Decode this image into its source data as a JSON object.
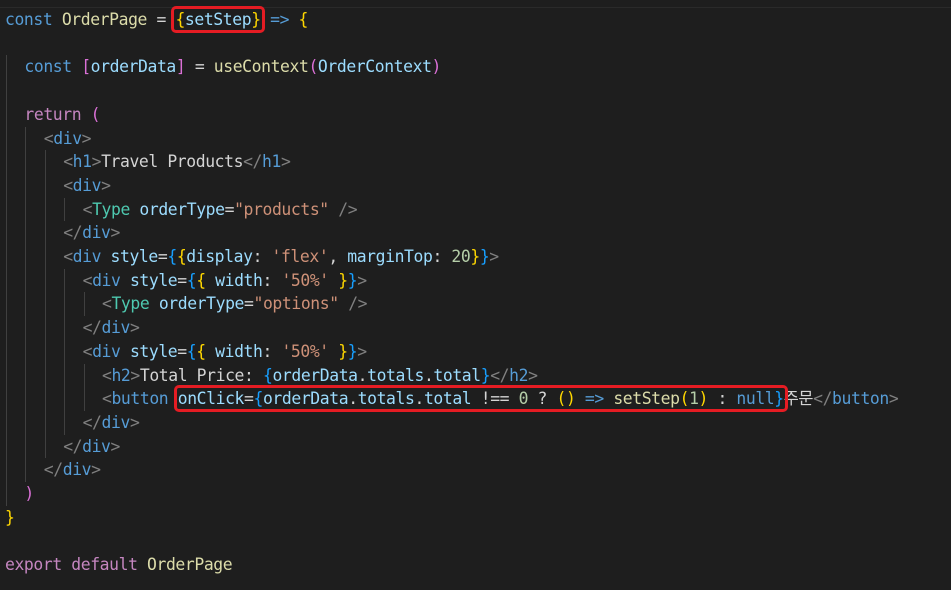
{
  "editor": {
    "lines": [
      {
        "indent": 0,
        "tokens": [
          {
            "t": "const",
            "c": "kw"
          },
          {
            "t": " ",
            "c": "p"
          },
          {
            "t": "OrderPage",
            "c": "func"
          },
          {
            "t": " = ",
            "c": "p"
          },
          {
            "t": "{",
            "c": "br1",
            "box": "a"
          },
          {
            "t": "setStep",
            "c": "var",
            "box": "a"
          },
          {
            "t": "}",
            "c": "br1",
            "box": "a"
          },
          {
            "t": " ",
            "c": "p"
          },
          {
            "t": "=>",
            "c": "kw"
          },
          {
            "t": " ",
            "c": "p"
          },
          {
            "t": "{",
            "c": "br1"
          }
        ]
      },
      {
        "indent": 0,
        "tokens": []
      },
      {
        "indent": 1,
        "tokens": [
          {
            "t": "const",
            "c": "kw"
          },
          {
            "t": " ",
            "c": "p"
          },
          {
            "t": "[",
            "c": "br2"
          },
          {
            "t": "orderData",
            "c": "var"
          },
          {
            "t": "]",
            "c": "br2"
          },
          {
            "t": " = ",
            "c": "p"
          },
          {
            "t": "useContext",
            "c": "func"
          },
          {
            "t": "(",
            "c": "br2"
          },
          {
            "t": "OrderContext",
            "c": "var"
          },
          {
            "t": ")",
            "c": "br2"
          }
        ]
      },
      {
        "indent": 0,
        "tokens": []
      },
      {
        "indent": 1,
        "tokens": [
          {
            "t": "return",
            "c": "ctrl"
          },
          {
            "t": " ",
            "c": "p"
          },
          {
            "t": "(",
            "c": "br2"
          }
        ]
      },
      {
        "indent": 2,
        "tokens": [
          {
            "t": "<",
            "c": "tagp"
          },
          {
            "t": "div",
            "c": "tag"
          },
          {
            "t": ">",
            "c": "tagp"
          }
        ]
      },
      {
        "indent": 3,
        "tokens": [
          {
            "t": "<",
            "c": "tagp"
          },
          {
            "t": "h1",
            "c": "tag"
          },
          {
            "t": ">",
            "c": "tagp"
          },
          {
            "t": "Travel Products",
            "c": "text"
          },
          {
            "t": "</",
            "c": "tagp"
          },
          {
            "t": "h1",
            "c": "tag"
          },
          {
            "t": ">",
            "c": "tagp"
          }
        ]
      },
      {
        "indent": 3,
        "tokens": [
          {
            "t": "<",
            "c": "tagp"
          },
          {
            "t": "div",
            "c": "tag"
          },
          {
            "t": ">",
            "c": "tagp"
          }
        ]
      },
      {
        "indent": 4,
        "tokens": [
          {
            "t": "<",
            "c": "tagp"
          },
          {
            "t": "Type",
            "c": "comp"
          },
          {
            "t": " ",
            "c": "p"
          },
          {
            "t": "orderType",
            "c": "attr"
          },
          {
            "t": "=",
            "c": "p"
          },
          {
            "t": "\"products\"",
            "c": "str"
          },
          {
            "t": " ",
            "c": "p"
          },
          {
            "t": "/>",
            "c": "tagp"
          }
        ]
      },
      {
        "indent": 3,
        "tokens": [
          {
            "t": "</",
            "c": "tagp"
          },
          {
            "t": "div",
            "c": "tag"
          },
          {
            "t": ">",
            "c": "tagp"
          }
        ]
      },
      {
        "indent": 3,
        "tokens": [
          {
            "t": "<",
            "c": "tagp"
          },
          {
            "t": "div",
            "c": "tag"
          },
          {
            "t": " ",
            "c": "p"
          },
          {
            "t": "style",
            "c": "attr"
          },
          {
            "t": "=",
            "c": "p"
          },
          {
            "t": "{",
            "c": "br3"
          },
          {
            "t": "{",
            "c": "br1"
          },
          {
            "t": "display",
            "c": "attr"
          },
          {
            "t": ": ",
            "c": "p"
          },
          {
            "t": "'flex'",
            "c": "str"
          },
          {
            "t": ", ",
            "c": "p"
          },
          {
            "t": "marginTop",
            "c": "attr"
          },
          {
            "t": ": ",
            "c": "p"
          },
          {
            "t": "20",
            "c": "num"
          },
          {
            "t": "}",
            "c": "br1"
          },
          {
            "t": "}",
            "c": "br3"
          },
          {
            "t": ">",
            "c": "tagp"
          }
        ]
      },
      {
        "indent": 4,
        "tokens": [
          {
            "t": "<",
            "c": "tagp"
          },
          {
            "t": "div",
            "c": "tag"
          },
          {
            "t": " ",
            "c": "p"
          },
          {
            "t": "style",
            "c": "attr"
          },
          {
            "t": "=",
            "c": "p"
          },
          {
            "t": "{",
            "c": "br3"
          },
          {
            "t": "{",
            "c": "br1"
          },
          {
            "t": " ",
            "c": "p"
          },
          {
            "t": "width",
            "c": "attr"
          },
          {
            "t": ": ",
            "c": "p"
          },
          {
            "t": "'50%'",
            "c": "str"
          },
          {
            "t": " ",
            "c": "p"
          },
          {
            "t": "}",
            "c": "br1"
          },
          {
            "t": "}",
            "c": "br3"
          },
          {
            "t": ">",
            "c": "tagp"
          }
        ]
      },
      {
        "indent": 5,
        "tokens": [
          {
            "t": "<",
            "c": "tagp"
          },
          {
            "t": "Type",
            "c": "comp"
          },
          {
            "t": " ",
            "c": "p"
          },
          {
            "t": "orderType",
            "c": "attr"
          },
          {
            "t": "=",
            "c": "p"
          },
          {
            "t": "\"options\"",
            "c": "str"
          },
          {
            "t": " ",
            "c": "p"
          },
          {
            "t": "/>",
            "c": "tagp"
          }
        ]
      },
      {
        "indent": 4,
        "tokens": [
          {
            "t": "</",
            "c": "tagp"
          },
          {
            "t": "div",
            "c": "tag"
          },
          {
            "t": ">",
            "c": "tagp"
          }
        ]
      },
      {
        "indent": 4,
        "tokens": [
          {
            "t": "<",
            "c": "tagp"
          },
          {
            "t": "div",
            "c": "tag"
          },
          {
            "t": " ",
            "c": "p"
          },
          {
            "t": "style",
            "c": "attr"
          },
          {
            "t": "=",
            "c": "p"
          },
          {
            "t": "{",
            "c": "br3"
          },
          {
            "t": "{",
            "c": "br1"
          },
          {
            "t": " ",
            "c": "p"
          },
          {
            "t": "width",
            "c": "attr"
          },
          {
            "t": ": ",
            "c": "p"
          },
          {
            "t": "'50%'",
            "c": "str"
          },
          {
            "t": " ",
            "c": "p"
          },
          {
            "t": "}",
            "c": "br1"
          },
          {
            "t": "}",
            "c": "br3"
          },
          {
            "t": ">",
            "c": "tagp"
          }
        ]
      },
      {
        "indent": 5,
        "tokens": [
          {
            "t": "<",
            "c": "tagp"
          },
          {
            "t": "h2",
            "c": "tag"
          },
          {
            "t": ">",
            "c": "tagp"
          },
          {
            "t": "Total Price: ",
            "c": "text"
          },
          {
            "t": "{",
            "c": "br3"
          },
          {
            "t": "orderData",
            "c": "var"
          },
          {
            "t": ".",
            "c": "p"
          },
          {
            "t": "totals",
            "c": "var"
          },
          {
            "t": ".",
            "c": "p"
          },
          {
            "t": "total",
            "c": "var"
          },
          {
            "t": "}",
            "c": "br3"
          },
          {
            "t": "</",
            "c": "tagp"
          },
          {
            "t": "h2",
            "c": "tag"
          },
          {
            "t": ">",
            "c": "tagp"
          }
        ]
      },
      {
        "indent": 5,
        "tokens": [
          {
            "t": "<",
            "c": "tagp"
          },
          {
            "t": "button",
            "c": "tag"
          },
          {
            "t": " ",
            "c": "p"
          },
          {
            "t": "onClick",
            "c": "attr",
            "box": "b"
          },
          {
            "t": "=",
            "c": "p",
            "box": "b"
          },
          {
            "t": "{",
            "c": "br3",
            "box": "b"
          },
          {
            "t": "orderData",
            "c": "var",
            "box": "b"
          },
          {
            "t": ".",
            "c": "p",
            "box": "b"
          },
          {
            "t": "totals",
            "c": "var",
            "box": "b"
          },
          {
            "t": ".",
            "c": "p",
            "box": "b"
          },
          {
            "t": "total",
            "c": "var",
            "box": "b"
          },
          {
            "t": " ",
            "c": "p",
            "box": "b"
          },
          {
            "t": "!==",
            "c": "p",
            "box": "b"
          },
          {
            "t": " ",
            "c": "p",
            "box": "b"
          },
          {
            "t": "0",
            "c": "num",
            "box": "b"
          },
          {
            "t": " ? ",
            "c": "p",
            "box": "b"
          },
          {
            "t": "()",
            "c": "br1",
            "box": "b"
          },
          {
            "t": " ",
            "c": "p",
            "box": "b"
          },
          {
            "t": "=>",
            "c": "kw",
            "box": "b"
          },
          {
            "t": " ",
            "c": "p",
            "box": "b"
          },
          {
            "t": "setStep",
            "c": "func",
            "box": "b"
          },
          {
            "t": "(",
            "c": "br1",
            "box": "b"
          },
          {
            "t": "1",
            "c": "num",
            "box": "b"
          },
          {
            "t": ")",
            "c": "br1",
            "box": "b"
          },
          {
            "t": " : ",
            "c": "p",
            "box": "b"
          },
          {
            "t": "null",
            "c": "kw",
            "box": "b"
          },
          {
            "t": "}",
            "c": "br3",
            "box": "b"
          },
          {
            "t": "주문",
            "c": "text"
          },
          {
            "t": "</",
            "c": "tagp"
          },
          {
            "t": "button",
            "c": "tag"
          },
          {
            "t": ">",
            "c": "tagp"
          }
        ]
      },
      {
        "indent": 4,
        "tokens": [
          {
            "t": "</",
            "c": "tagp"
          },
          {
            "t": "div",
            "c": "tag"
          },
          {
            "t": ">",
            "c": "tagp"
          }
        ]
      },
      {
        "indent": 3,
        "tokens": [
          {
            "t": "</",
            "c": "tagp"
          },
          {
            "t": "div",
            "c": "tag"
          },
          {
            "t": ">",
            "c": "tagp"
          }
        ]
      },
      {
        "indent": 2,
        "tokens": [
          {
            "t": "</",
            "c": "tagp"
          },
          {
            "t": "div",
            "c": "tag"
          },
          {
            "t": ">",
            "c": "tagp"
          }
        ]
      },
      {
        "indent": 1,
        "tokens": [
          {
            "t": ")",
            "c": "br2"
          }
        ]
      },
      {
        "indent": 0,
        "tokens": [
          {
            "t": "}",
            "c": "br1"
          }
        ]
      },
      {
        "indent": 0,
        "tokens": []
      },
      {
        "indent": 0,
        "tokens": [
          {
            "t": "export",
            "c": "ctrl"
          },
          {
            "t": " ",
            "c": "p"
          },
          {
            "t": "default",
            "c": "ctrl"
          },
          {
            "t": " ",
            "c": "p"
          },
          {
            "t": "OrderPage",
            "c": "func"
          }
        ]
      }
    ]
  },
  "theme": {
    "background": "#1e1e1e",
    "highlight_outline": "#e51c23",
    "indent_guide": "#404040",
    "colors": {
      "kw": "#569cd6",
      "ctrl": "#c586c0",
      "func": "#dcdcaa",
      "var": "#9cdcfe",
      "attr": "#9cdcfe",
      "str": "#ce9178",
      "num": "#b5cea8",
      "tag": "#569cd6",
      "tagp": "#808080",
      "comp": "#4ec9b0",
      "text": "#d4d4d4",
      "p": "#d4d4d4",
      "br1": "#ffd700",
      "br2": "#da70d6",
      "br3": "#179fff"
    }
  }
}
